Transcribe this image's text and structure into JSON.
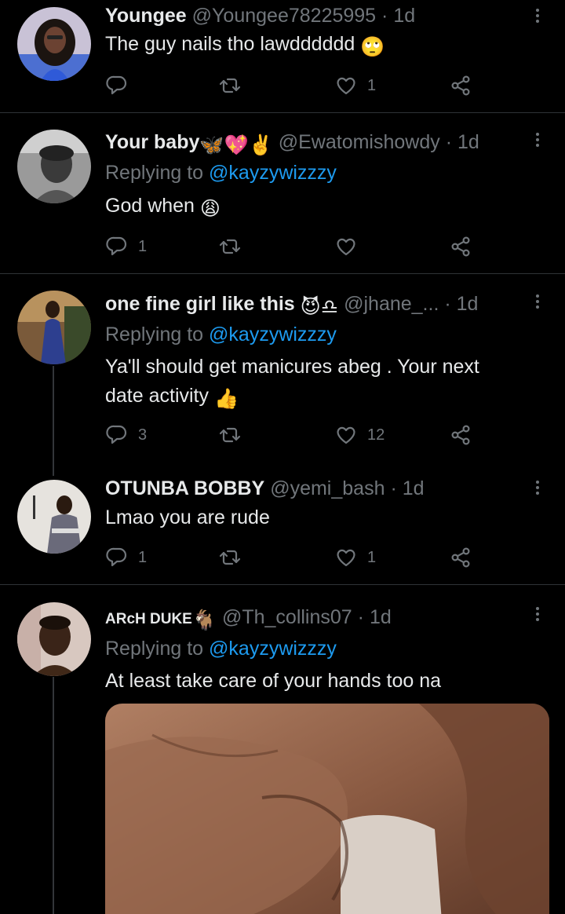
{
  "tweets": [
    {
      "name": "Youngee",
      "handle": "@Youngee78225995",
      "time": "1d",
      "reply_prefix": "",
      "reply_mention": "",
      "body": "The guy nails tho lawdddddd",
      "emoji": "🙄",
      "replies": "",
      "retweets": "",
      "likes": "1"
    },
    {
      "name": "Your baby",
      "name_emojis": "🦋💖✌️",
      "handle": "@Ewatomishowdy",
      "time": "1d",
      "reply_prefix": "Replying to",
      "reply_mention": "@kayzywizzzy",
      "body": "God when",
      "emoji": "😩",
      "replies": "1",
      "retweets": "",
      "likes": ""
    },
    {
      "name": "one fine girl like this",
      "name_emojis": "😈♎",
      "handle": "@jhane_...",
      "time": "1d",
      "reply_prefix": "Replying to",
      "reply_mention": "@kayzywizzzy",
      "body_line1": "Ya'll should get manicures abeg . Your next",
      "body_line2": "date activity",
      "emoji": "👍",
      "replies": "3",
      "retweets": "",
      "likes": "12"
    },
    {
      "name": "OTUNBA BOBBY",
      "handle": "@yemi_bash",
      "time": "1d",
      "body": "Lmao you are rude",
      "replies": "1",
      "retweets": "",
      "likes": "1"
    },
    {
      "name": "ARcH DUKE",
      "name_emojis": "🐐",
      "handle": "@Th_collins07",
      "time": "1d",
      "reply_prefix": "Replying to",
      "reply_mention": "@kayzywizzzy",
      "body": "At least take care of your hands too na"
    }
  ],
  "separator": "·",
  "colors": {
    "background": "#000000",
    "text": "#e7e9ea",
    "muted": "#71767b",
    "link": "#1d9bf0",
    "divider": "#2f3336"
  },
  "icons": [
    "reply-icon",
    "retweet-icon",
    "like-icon",
    "share-icon",
    "more-icon"
  ]
}
